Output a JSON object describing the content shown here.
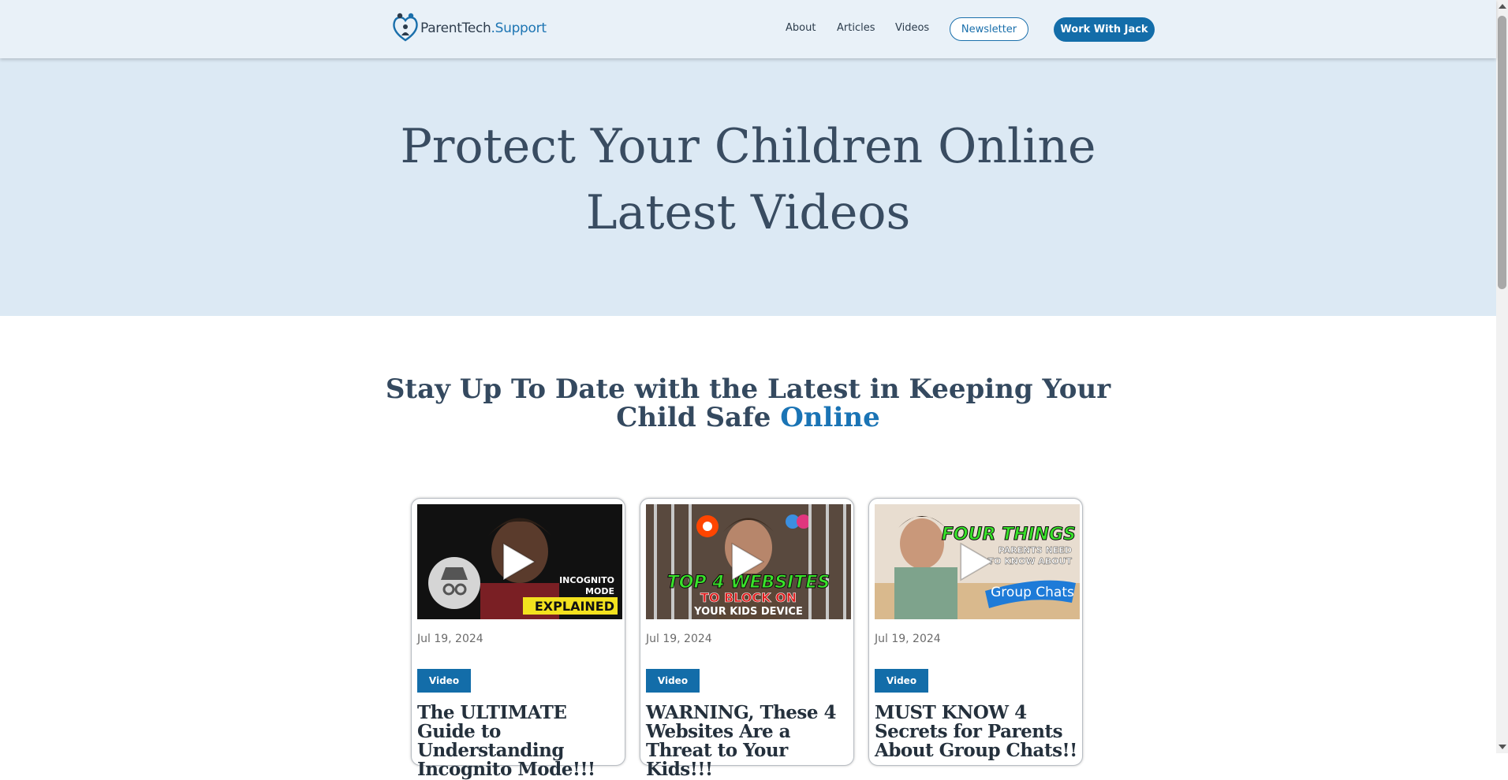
{
  "header": {
    "logo": {
      "part1": "ParentTech",
      "part2": ".Support",
      "icon": "family-heart-icon"
    },
    "nav": [
      "About",
      "Articles",
      "Videos"
    ],
    "newsletter_label": "Newsletter",
    "cta_label": "Work With Jack"
  },
  "hero": {
    "line1": "Protect Your Children Online",
    "line2": "Latest Videos"
  },
  "section": {
    "title_main": "Stay Up To Date with the Latest in Keeping Your",
    "title_line2": "Child Safe ",
    "title_accent": "Online"
  },
  "cards": [
    {
      "date": "Jul 19, 2024",
      "badge": "Video",
      "title": "The ULTIMATE Guide to Understanding Incognito Mode!!!",
      "thumb_text": [
        "INCOGNITO",
        "MODE",
        "EXPLAINED"
      ]
    },
    {
      "date": "Jul 19, 2024",
      "badge": "Video",
      "title": "WARNING, These 4 Websites Are a Threat to Your Kids!!!",
      "thumb_text": [
        "TOP 4 WEBSITES",
        "TO BLOCK ON",
        "YOUR KIDS DEVICE"
      ]
    },
    {
      "date": "Jul 19, 2024",
      "badge": "Video",
      "title": "MUST KNOW 4 Secrets for Parents About Group Chats!!",
      "thumb_text": [
        "FOUR THINGS",
        "PARENTS NEED",
        "TO KNOW ABOUT",
        "Group Chats"
      ]
    }
  ],
  "colors": {
    "brand": "#136da9",
    "hero_bg": "#dce9f4",
    "header_bg": "#e9f1f8",
    "heading": "#34495f"
  }
}
